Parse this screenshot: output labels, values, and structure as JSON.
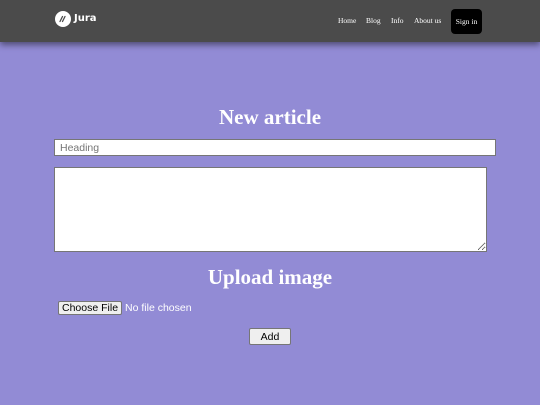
{
  "brand": {
    "name": "Jura",
    "logo_icon": "slash-mark-icon"
  },
  "nav": {
    "links": [
      "Home",
      "Blog",
      "Info",
      "About us"
    ],
    "signin_label": "Sign in"
  },
  "main": {
    "title": "New article",
    "heading_placeholder": "Heading",
    "heading_value": "",
    "body_value": ""
  },
  "upload": {
    "title": "Upload image",
    "choose_file_label": "Choose File",
    "file_status": "No file chosen"
  },
  "actions": {
    "add_label": "Add"
  },
  "colors": {
    "page_background": "#928bd5",
    "navbar_background": "#4b4b4b",
    "signin_background": "#000000"
  }
}
